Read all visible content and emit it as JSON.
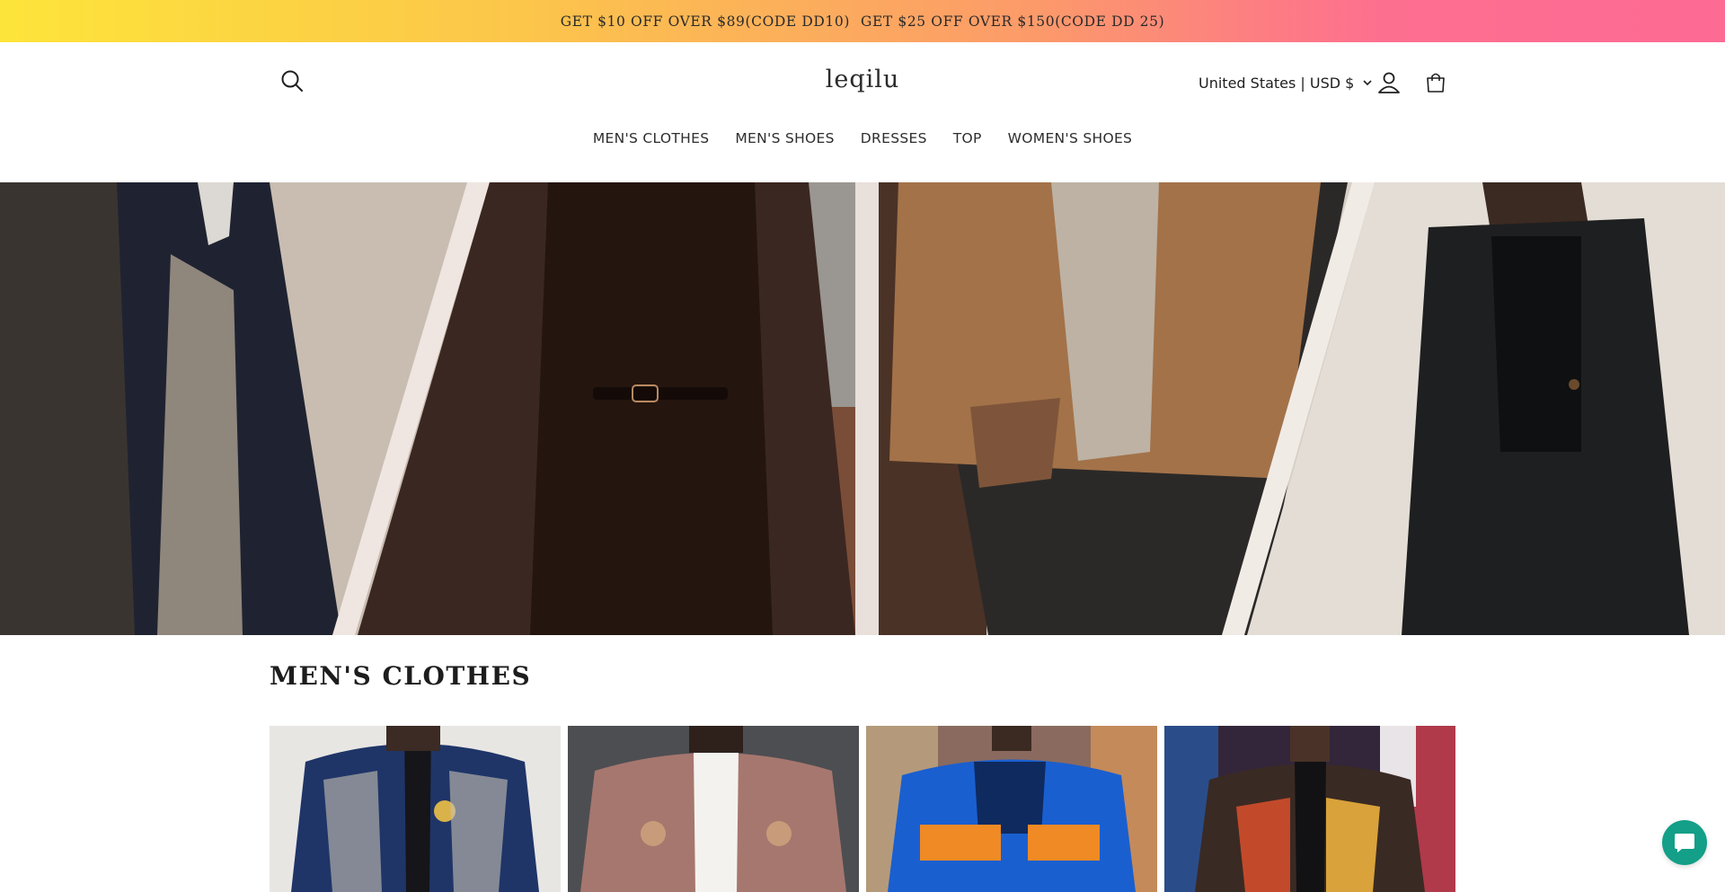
{
  "announcement": {
    "offer_1": "GET $10 OFF OVER $89(CODE DD10)",
    "offer_2": "GET $25 OFF OVER $150(CODE DD 25)"
  },
  "header": {
    "logo": "leqilu",
    "locale": "United States | USD $",
    "icons": {
      "search": "search-icon",
      "account": "account-icon",
      "cart": "cart-icon",
      "locale_chevron": "chevron-down-icon"
    }
  },
  "nav": {
    "items": [
      "MEN'S CLOTHES",
      "MEN'S SHOES",
      "DRESSES",
      "TOP",
      "WOMEN'S SHOES"
    ]
  },
  "section": {
    "title": "MEN'S CLOTHES"
  },
  "chat": {
    "icon": "chat-icon",
    "color": "#139f88"
  },
  "colors": {
    "announcement_gradient_start": "#fde43a",
    "announcement_gradient_end": "#fd6a94"
  }
}
